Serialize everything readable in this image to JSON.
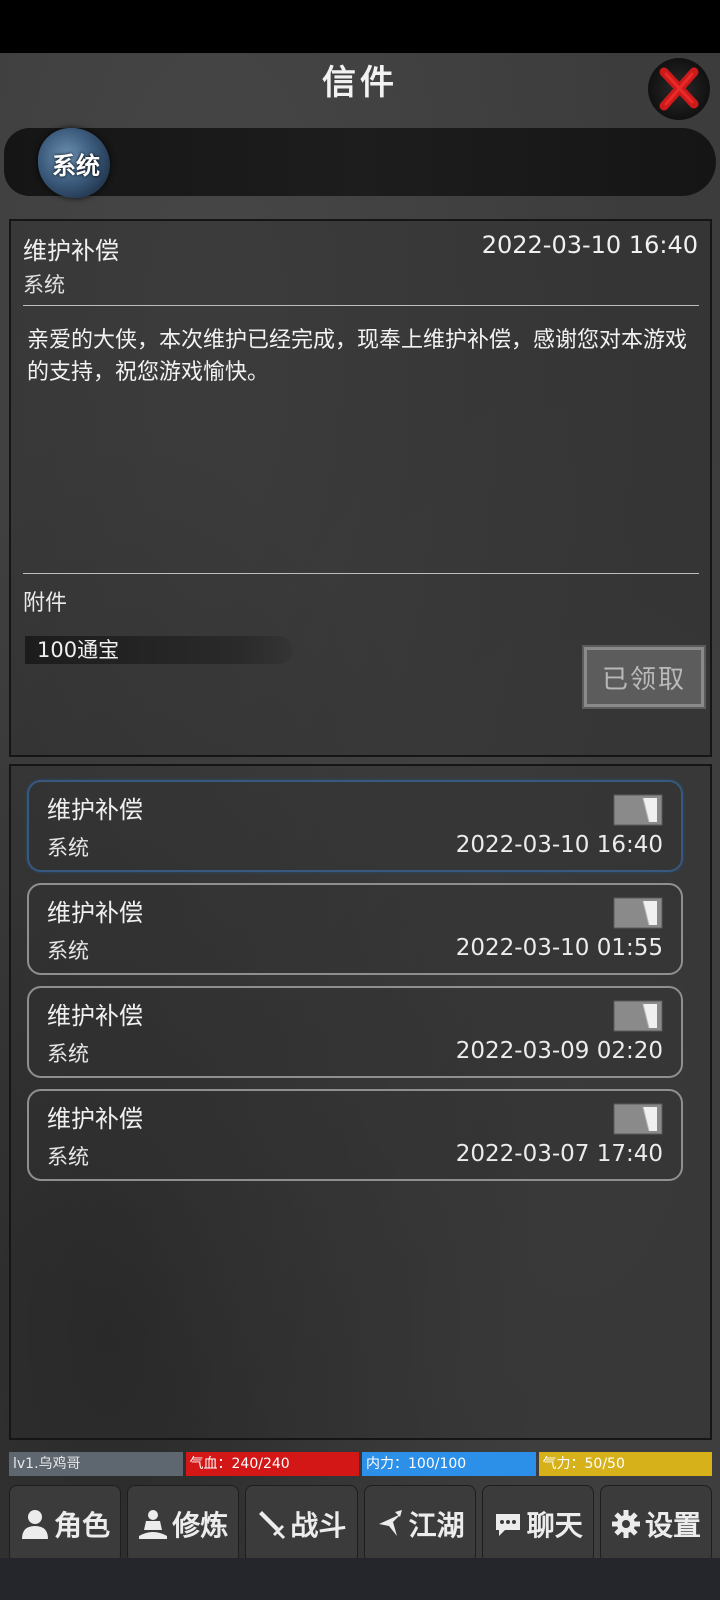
{
  "window": {
    "title": "信件"
  },
  "tabs": [
    {
      "label": "系统",
      "active": true
    }
  ],
  "detail": {
    "subject": "维护补偿",
    "time": "2022-03-10 16:40",
    "sender": "系统",
    "body": "亲爱的大侠，本次维护已经完成，现奉上维护补偿，感谢您对本游戏的支持，祝您游戏愉快。",
    "attachment_label": "附件",
    "attachment_item": "100通宝",
    "claim_status": "已领取"
  },
  "mail_list": [
    {
      "subject": "维护补偿",
      "sender": "系统",
      "time": "2022-03-10 16:40",
      "selected": true
    },
    {
      "subject": "维护补偿",
      "sender": "系统",
      "time": "2022-03-10 01:55",
      "selected": false
    },
    {
      "subject": "维护补偿",
      "sender": "系统",
      "time": "2022-03-09 02:20",
      "selected": false
    },
    {
      "subject": "维护补偿",
      "sender": "系统",
      "time": "2022-03-07 17:40",
      "selected": false
    }
  ],
  "stats": {
    "level": "lv1.乌鸡哥",
    "hp": "气血：240/240",
    "mp": "内力：100/100",
    "stamina": "气力：50/50"
  },
  "nav": [
    {
      "label": "角色",
      "icon": "person-icon"
    },
    {
      "label": "修炼",
      "icon": "meditate-icon"
    },
    {
      "label": "战斗",
      "icon": "sword-icon"
    },
    {
      "label": "江湖",
      "icon": "jianghu-icon"
    },
    {
      "label": "聊天",
      "icon": "chat-icon"
    },
    {
      "label": "设置",
      "icon": "gear-icon"
    }
  ],
  "colors": {
    "hp": "#d31616",
    "mp": "#2c8fe8",
    "stamina": "#d6b11a",
    "close": "#cc1a1a",
    "selected_border": "#36597d"
  }
}
